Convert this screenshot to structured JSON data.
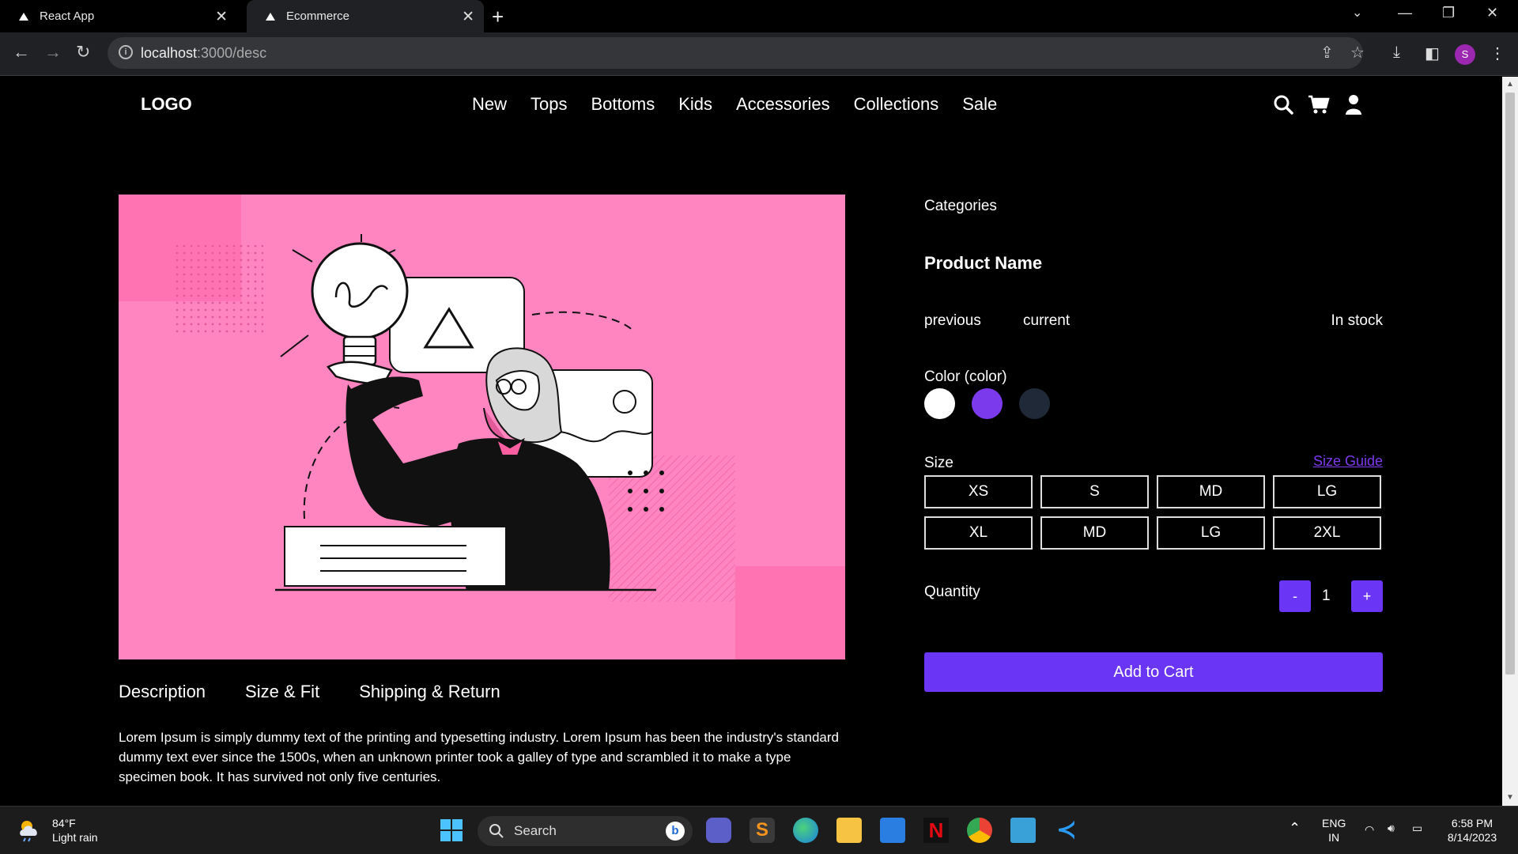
{
  "browser": {
    "tabs": [
      {
        "title": "React App"
      },
      {
        "title": "Ecommerce"
      }
    ],
    "url_host": "localhost",
    "url_path": ":3000/desc",
    "profile_initial": "S"
  },
  "header": {
    "logo": "LOGO",
    "nav": [
      "New",
      "Tops",
      "Bottoms",
      "Kids",
      "Accessories",
      "Collections",
      "Sale"
    ]
  },
  "product": {
    "category": "Categories",
    "name": "Product Name",
    "price_previous": "previous",
    "price_current": "current",
    "stock": "In stock",
    "color_label": "Color (color)",
    "colors": [
      "#ffffff",
      "#7c3aed",
      "#1f2937"
    ],
    "size_label": "Size",
    "size_guide": "Size Guide",
    "sizes": [
      "XS",
      "S",
      "MD",
      "LG",
      "XL",
      "MD",
      "LG",
      "2XL"
    ],
    "quantity_label": "Quantity",
    "quantity_minus": "-",
    "quantity_value": "1",
    "quantity_plus": "+",
    "add_to_cart": "Add to Cart"
  },
  "details": {
    "tabs": [
      "Description",
      "Size & Fit",
      "Shipping & Return"
    ],
    "description": "Lorem Ipsum is simply dummy text of the printing and typesetting industry. Lorem Ipsum has been the industry's standard dummy text ever since the 1500s, when an unknown printer took a galley of type and scrambled it to make a type specimen book. It has survived not only five centuries."
  },
  "colors": {
    "accent": "#6b35f5",
    "hero_bg": "#ff85c0",
    "page_bg": "#000000"
  },
  "taskbar": {
    "weather_temp": "84°F",
    "weather_desc": "Light rain",
    "search": "Search",
    "lang": "ENG",
    "region": "IN",
    "time": "6:58 PM",
    "date": "8/14/2023"
  }
}
